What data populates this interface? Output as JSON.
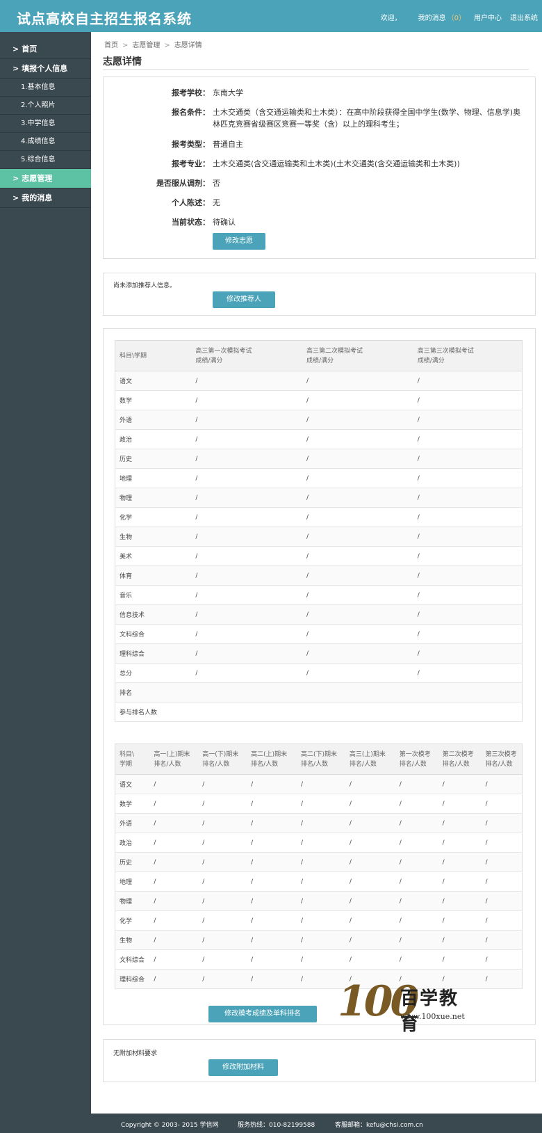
{
  "header": {
    "title": "试点高校自主招生报名系统",
    "welcome": "欢迎，",
    "messages": "我的消息",
    "message_count": "（0）",
    "user_center": "用户中心",
    "logout": "退出系统"
  },
  "sidebar": {
    "items": [
      {
        "label": "首页",
        "prefix": ">"
      },
      {
        "label": "填报个人信息",
        "prefix": ">"
      },
      {
        "label": "1.基本信息"
      },
      {
        "label": "2.个人照片"
      },
      {
        "label": "3.中学信息"
      },
      {
        "label": "4.成绩信息"
      },
      {
        "label": "5.综合信息"
      },
      {
        "label": "志愿管理",
        "prefix": ">"
      },
      {
        "label": "我的消息",
        "prefix": ">"
      }
    ]
  },
  "breadcrumb": {
    "home": "首页",
    "sep": ">",
    "section": "志愿管理",
    "current": "志愿详情"
  },
  "page_title": "志愿详情",
  "application": {
    "school_label": "报考学校：",
    "school": "东南大学",
    "condition_label": "报名条件：",
    "condition": "土木交通类（含交通运输类和土木类）：在高中阶段获得全国中学生(数学、物理、信息学)奥林匹克竞赛省级赛区竞赛一等奖（含）以上的理科考生；",
    "type_label": "报考类型：",
    "type": "普通自主",
    "major_label": "报考专业：",
    "major": "土木交通类(含交通运输类和土木类)(土木交通类(含交通运输类和土木类))",
    "adjust_label": "是否服从调剂：",
    "adjust": "否",
    "statement_label": "个人陈述：",
    "statement": "无",
    "status_label": "当前状态：",
    "status": "待确认",
    "edit_button": "修改志愿"
  },
  "referrer": {
    "note": "尚未添加推荐人信息。",
    "button": "修改推荐人"
  },
  "mock_table": {
    "headers": [
      "科目\\学期",
      "高三第一次模拟考试\n成绩/满分",
      "高三第二次模拟考试\n成绩/满分",
      "高三第三次模拟考试\n成绩/满分"
    ],
    "rows": [
      [
        "语文",
        "/",
        "/",
        "/"
      ],
      [
        "数学",
        "/",
        "/",
        "/"
      ],
      [
        "外语",
        "/",
        "/",
        "/"
      ],
      [
        "政治",
        "/",
        "/",
        "/"
      ],
      [
        "历史",
        "/",
        "/",
        "/"
      ],
      [
        "地理",
        "/",
        "/",
        "/"
      ],
      [
        "物理",
        "/",
        "/",
        "/"
      ],
      [
        "化学",
        "/",
        "/",
        "/"
      ],
      [
        "生物",
        "/",
        "/",
        "/"
      ],
      [
        "美术",
        "/",
        "/",
        "/"
      ],
      [
        "体育",
        "/",
        "/",
        "/"
      ],
      [
        "音乐",
        "/",
        "/",
        "/"
      ],
      [
        "信息技术",
        "/",
        "/",
        "/"
      ],
      [
        "文科综合",
        "/",
        "/",
        "/"
      ],
      [
        "理科综合",
        "/",
        "/",
        "/"
      ],
      [
        "总分",
        "/",
        "/",
        "/"
      ],
      [
        "排名",
        "",
        "",
        ""
      ],
      [
        "参与排名人数",
        "",
        "",
        ""
      ]
    ]
  },
  "rank_table": {
    "headers": [
      "科目\\\n学期",
      "高一(上)期末\n排名/人数",
      "高一(下)期末\n排名/人数",
      "高二(上)期末\n排名/人数",
      "高二(下)期末\n排名/人数",
      "高三(上)期末\n排名/人数",
      "第一次模考\n排名/人数",
      "第二次模考\n排名/人数",
      "第三次模考\n排名/人数"
    ],
    "rows": [
      [
        "语文",
        "/",
        "/",
        "/",
        "/",
        "/",
        "/",
        "/",
        "/"
      ],
      [
        "数学",
        "/",
        "/",
        "/",
        "/",
        "/",
        "/",
        "/",
        "/"
      ],
      [
        "外语",
        "/",
        "/",
        "/",
        "/",
        "/",
        "/",
        "/",
        "/"
      ],
      [
        "政治",
        "/",
        "/",
        "/",
        "/",
        "/",
        "/",
        "/",
        "/"
      ],
      [
        "历史",
        "/",
        "/",
        "/",
        "/",
        "/",
        "/",
        "/",
        "/"
      ],
      [
        "地理",
        "/",
        "/",
        "/",
        "/",
        "/",
        "/",
        "/",
        "/"
      ],
      [
        "物理",
        "/",
        "/",
        "/",
        "/",
        "/",
        "/",
        "/",
        "/"
      ],
      [
        "化学",
        "/",
        "/",
        "/",
        "/",
        "/",
        "/",
        "/",
        "/"
      ],
      [
        "生物",
        "/",
        "/",
        "/",
        "/",
        "/",
        "/",
        "/",
        "/"
      ],
      [
        "文科综合",
        "/",
        "/",
        "/",
        "/",
        "/",
        "/",
        "/",
        "/"
      ],
      [
        "理科综合",
        "/",
        "/",
        "/",
        "/",
        "/",
        "/",
        "/",
        "/"
      ]
    ],
    "button": "修改模考成绩及单科排名"
  },
  "attachments": {
    "note": "无附加材料要求",
    "button": "修改附加材料"
  },
  "watermark": {
    "number": "100",
    "name": "百学教育",
    "url": "www.100xue.net"
  },
  "footer": {
    "copyright": "Copyright © 2003- 2015 学信网",
    "hotline": "服务热线：010-82199588",
    "email": "客服邮箱：kefu@chsi.com.cn"
  }
}
